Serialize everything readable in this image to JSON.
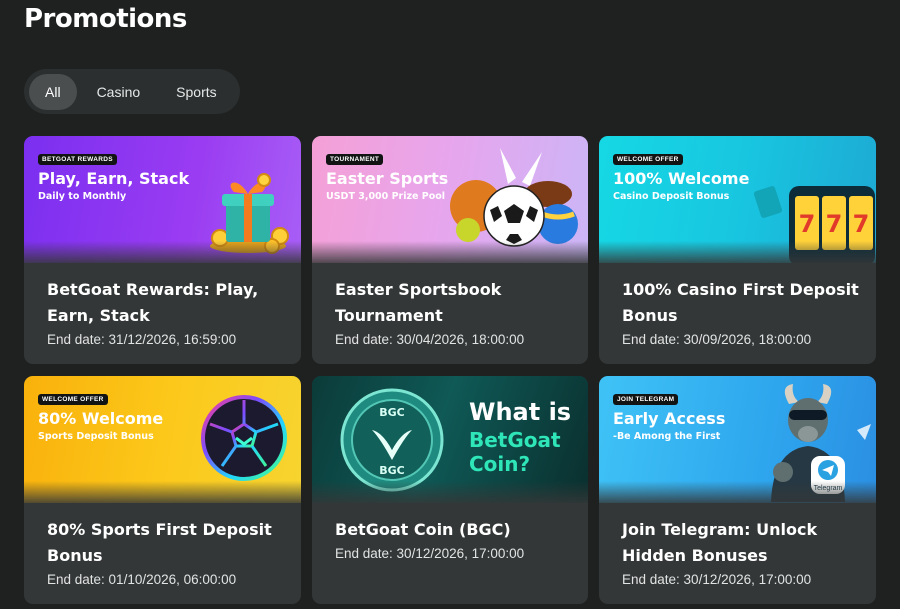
{
  "page": {
    "title": "Promotions"
  },
  "filters": [
    {
      "label": "All",
      "active": true
    },
    {
      "label": "Casino",
      "active": false
    },
    {
      "label": "Sports",
      "active": false
    }
  ],
  "promotions": [
    {
      "tag": "BETGOAT REWARDS",
      "banner_title": "Play, Earn, Stack",
      "banner_subtitle": "Daily to Monthly",
      "title": "BetGoat Rewards: Play, Earn, Stack",
      "end_date": "End date: 31/12/2026, 16:59:00",
      "illustration": "gift-box-icon"
    },
    {
      "tag": "TOURNAMENT",
      "banner_title": "Easter Sports",
      "banner_subtitle": "USDT 3,000 Prize Pool",
      "title": "Easter Sportsbook Tournament",
      "end_date": "End date: 30/04/2026, 18:00:00",
      "illustration": "sports-balls-icon"
    },
    {
      "tag": "WELCOME OFFER",
      "banner_title": "100% Welcome",
      "banner_subtitle": "Casino Deposit Bonus",
      "title": "100% Casino First Deposit Bonus",
      "end_date": "End date: 30/09/2026, 18:00:00",
      "illustration": "slot-machine-icon"
    },
    {
      "tag": "WELCOME OFFER",
      "banner_title": "80% Welcome",
      "banner_subtitle": "Sports Deposit Bonus",
      "title": "80% Sports First Deposit Bonus",
      "end_date": "End date: 01/10/2026, 06:00:00",
      "illustration": "neon-football-icon"
    },
    {
      "tag": "",
      "banner_title": "What is",
      "banner_title_2": "BetGoat",
      "banner_title_3": "Coin?",
      "coin_top": "BGC",
      "coin_bottom": "BGC",
      "title": "BetGoat Coin (BGC)",
      "end_date": "End date: 30/12/2026, 17:00:00",
      "illustration": "bgc-coin-icon"
    },
    {
      "tag": "JOIN TELEGRAM",
      "banner_title": "Early Access",
      "banner_subtitle": "-Be Among the First",
      "telegram_label": "Telegram",
      "title": "Join Telegram: Unlock Hidden Bonuses",
      "end_date": "End date: 30/12/2026, 17:00:00",
      "illustration": "goat-mascot-icon"
    }
  ]
}
